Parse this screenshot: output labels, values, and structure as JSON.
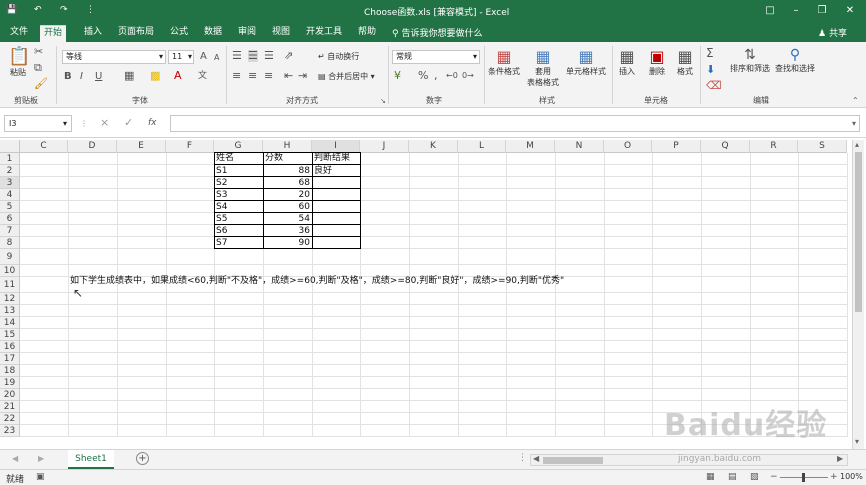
{
  "titlebar": {
    "title": "Choose函数.xls [兼容模式] - Excel",
    "save_icon": "save-icon",
    "undo_icon": "undo-icon",
    "redo_icon": "redo-icon",
    "customize_icon": "chevron-down-icon"
  },
  "tabs": {
    "items": [
      {
        "label": "文件"
      },
      {
        "label": "开始"
      },
      {
        "label": "插入"
      },
      {
        "label": "页面布局"
      },
      {
        "label": "公式"
      },
      {
        "label": "数据"
      },
      {
        "label": "审阅"
      },
      {
        "label": "视图"
      },
      {
        "label": "开发工具"
      },
      {
        "label": "帮助"
      }
    ],
    "active_index": 1,
    "tellme": "告诉我你想要做什么",
    "share": "共享"
  },
  "ribbon": {
    "clipboard": {
      "paste": "粘贴",
      "group": "剪贴板"
    },
    "font": {
      "name": "等线",
      "size": "11",
      "bold": "B",
      "italic": "I",
      "underline": "U",
      "grow": "A",
      "shrink": "A",
      "group": "字体"
    },
    "alignment": {
      "wrap": "自动换行",
      "merge": "合并后居中",
      "group": "对齐方式"
    },
    "number": {
      "format": "常规",
      "group": "数字"
    },
    "styles": {
      "conditional": "条件格式",
      "table_l1": "套用",
      "table_l2": "表格格式",
      "cell_styles": "单元格样式",
      "group": "样式"
    },
    "cells": {
      "insert": "插入",
      "delete": "删除",
      "format": "格式",
      "group": "单元格"
    },
    "editing": {
      "sort": "排序和筛选",
      "find": "查找和选择",
      "group": "编辑"
    }
  },
  "formula_bar": {
    "name_box": "I3",
    "cancel": "×",
    "enter": "✓",
    "fx": "fx",
    "value": ""
  },
  "grid": {
    "columns": [
      "C",
      "D",
      "E",
      "F",
      "G",
      "H",
      "I",
      "J",
      "K",
      "L",
      "M",
      "N",
      "O",
      "P",
      "Q",
      "R",
      "S"
    ],
    "rows": [
      "1",
      "2",
      "3",
      "4",
      "5",
      "6",
      "7",
      "8",
      "9",
      "10",
      "11",
      "12",
      "13",
      "14",
      "15",
      "16",
      "17",
      "18",
      "19",
      "20",
      "21",
      "22",
      "23"
    ],
    "table": {
      "headers": [
        "姓名",
        "分数",
        "判断结果"
      ],
      "rows": [
        {
          "name": "S1",
          "score": "88",
          "result": "良好"
        },
        {
          "name": "S2",
          "score": "68",
          "result": ""
        },
        {
          "name": "S3",
          "score": "20",
          "result": ""
        },
        {
          "name": "S4",
          "score": "60",
          "result": ""
        },
        {
          "name": "S5",
          "score": "54",
          "result": ""
        },
        {
          "name": "S6",
          "score": "36",
          "result": ""
        },
        {
          "name": "S7",
          "score": "90",
          "result": ""
        }
      ]
    },
    "note": "如下学生成绩表中，如果成绩<60,判断\"不及格\"，成绩>=60,判断\"及格\"，成绩>=80,判断\"良好\"，成绩>=90,判断\"优秀\""
  },
  "sheets": {
    "items": [
      {
        "label": "Sheet1"
      }
    ],
    "add": "+"
  },
  "status": {
    "mode": "就绪",
    "zoom": "100%",
    "watermark": "Baidu经验",
    "watermark_url": "jingyan.baidu.com"
  },
  "colors": {
    "accent": "#217346",
    "ribbon": "#f3f3f3"
  }
}
